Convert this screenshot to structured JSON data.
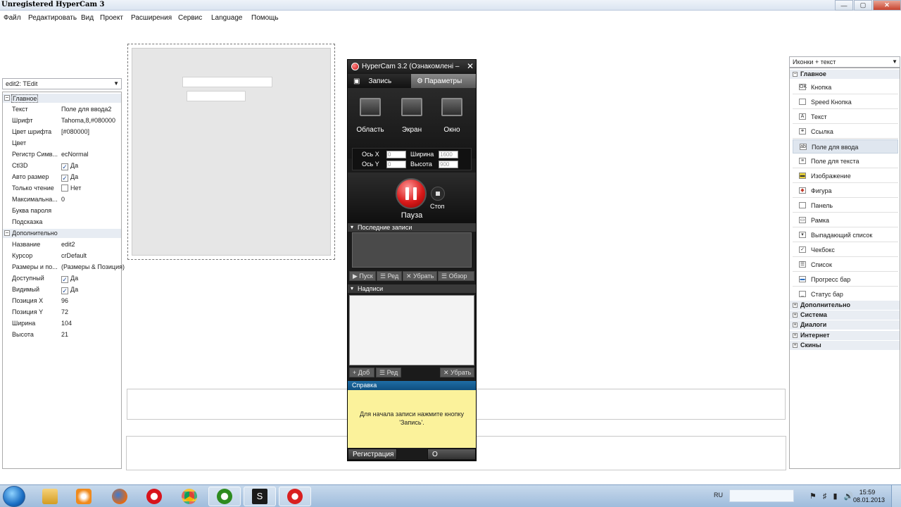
{
  "window": {
    "title": "Unregistered HyperCam 3",
    "controls": {
      "minimize": "—",
      "maximize": "▢",
      "close": "✕"
    }
  },
  "menu": [
    "Файл",
    "Редактировать",
    "Вид",
    "Проект",
    "Расширения",
    "Сервис",
    "Language",
    "Помощь"
  ],
  "inspector": {
    "selector": "edit2: TEdit",
    "groups": [
      {
        "name": "Главное",
        "rows": [
          {
            "key": "Текст",
            "value": "Поле для ввода2"
          },
          {
            "key": "Шрифт",
            "value": "Tahoma,8,#080000"
          },
          {
            "key": "Цвет шрифта",
            "value": "[#080000]"
          },
          {
            "key": "Цвет",
            "value": ""
          },
          {
            "key": "Регистр Симв...",
            "value": "ecNormal"
          },
          {
            "key": "Ctl3D",
            "value": "Да",
            "check": true
          },
          {
            "key": "Авто размер",
            "value": "Да",
            "check": true
          },
          {
            "key": "Только чтение",
            "value": "Нет",
            "check": false
          },
          {
            "key": "Максимальна...",
            "value": "0"
          },
          {
            "key": "Буква пароля",
            "value": ""
          },
          {
            "key": "Подсказка",
            "value": ""
          }
        ]
      },
      {
        "name": "Дополнительно",
        "rows": [
          {
            "key": "Название",
            "value": "edit2"
          },
          {
            "key": "Курсор",
            "value": "crDefault"
          },
          {
            "key": "Размеры и по...",
            "value": "(Размеры & Позиция)"
          },
          {
            "key": "Доступный",
            "value": "Да",
            "check": true
          },
          {
            "key": "Видимый",
            "value": "Да",
            "check": true
          },
          {
            "key": "Позиция X",
            "value": "96"
          },
          {
            "key": "Позиция Y",
            "value": "72"
          },
          {
            "key": "Ширина",
            "value": "104"
          },
          {
            "key": "Высота",
            "value": "21"
          }
        ]
      }
    ]
  },
  "hypercam": {
    "title": "HyperCam 3.2 (Ознакомлені –",
    "close": "✕",
    "tabs": {
      "record": "Запись",
      "params": "Параметры"
    },
    "modes": [
      "Область",
      "Экран",
      "Окно"
    ],
    "coords": {
      "x_label": "Ось X",
      "x_value": "0",
      "y_label": "Ось Y",
      "y_value": "0",
      "w_label": "Ширина",
      "w_value": "1600",
      "h_label": "Высота",
      "h_value": "900"
    },
    "pause_label": "Пауза",
    "stop_label": "Стоп",
    "recent_header": "Последние записи",
    "recent_buttons": {
      "play": "▶ Пуск",
      "edit": "☰ Ред",
      "remove": "✕ Убрать",
      "browse": "☰ Обзор"
    },
    "captions_header": "Надписи",
    "caption_buttons": {
      "add": "+ Доб",
      "edit": "☰ Ред",
      "remove": "✕ Убрать"
    },
    "help_header": "Справка",
    "help_text": "Для начала записи нажмите кнопку 'Запись'.",
    "footer": {
      "register": "Регистрация",
      "about": "О программе"
    }
  },
  "palette": {
    "view_mode": "Иконки + текст",
    "groups": [
      {
        "name": "Главное",
        "expanded": true,
        "items": [
          {
            "label": "Кнопка",
            "icon": "OK"
          },
          {
            "label": "Speed Кнопка",
            "icon": ""
          },
          {
            "label": "Текст",
            "icon": "A"
          },
          {
            "label": "Ссылка",
            "icon": "⚭"
          },
          {
            "label": "Поле для ввода",
            "icon": "ab",
            "selected": true
          },
          {
            "label": "Поле для текста",
            "icon": "≡"
          },
          {
            "label": "Изображение",
            "icon": "▬"
          },
          {
            "label": "Фигура",
            "icon": "◆"
          },
          {
            "label": "Панель",
            "icon": ""
          },
          {
            "label": "Рамка",
            "icon": "▭"
          },
          {
            "label": "Выпадающий список",
            "icon": "▾"
          },
          {
            "label": "Чекбокс",
            "icon": "✓"
          },
          {
            "label": "Список",
            "icon": "☰"
          },
          {
            "label": "Прогресс бар",
            "icon": "▬"
          },
          {
            "label": "Статус бар",
            "icon": "_"
          }
        ]
      },
      {
        "name": "Дополнительно",
        "expanded": false,
        "items": []
      },
      {
        "name": "Система",
        "expanded": false,
        "items": []
      },
      {
        "name": "Диалоги",
        "expanded": false,
        "items": []
      },
      {
        "name": "Интернет",
        "expanded": false,
        "items": []
      },
      {
        "name": "Скины",
        "expanded": false,
        "items": []
      }
    ]
  },
  "taskbar": {
    "language": "RU",
    "tray_icons": "⚑ ♯ ▮ 🔊",
    "time": "15:59",
    "date": "08.01.2013"
  }
}
